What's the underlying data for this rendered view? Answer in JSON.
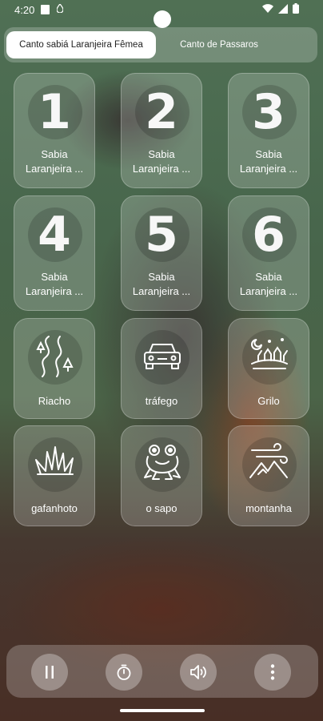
{
  "status_bar": {
    "time": "4:20",
    "drop_glyph": "•"
  },
  "tabs": [
    {
      "label": "Canto sabiá Laranjeira Fêmea",
      "active": true
    },
    {
      "label": "Canto de Passaros",
      "active": false
    }
  ],
  "sounds": [
    {
      "number": "1",
      "label_line1": "Sabia",
      "label_line2": "Laranjeira ..."
    },
    {
      "number": "2",
      "label_line1": "Sabia",
      "label_line2": "Laranjeira ..."
    },
    {
      "number": "3",
      "label_line1": "Sabia",
      "label_line2": "Laranjeira ..."
    },
    {
      "number": "4",
      "label_line1": "Sabia",
      "label_line2": "Laranjeira ..."
    },
    {
      "number": "5",
      "label_line1": "Sabia",
      "label_line2": "Laranjeira ..."
    },
    {
      "number": "6",
      "label_line1": "Sabia",
      "label_line2": "Laranjeira ..."
    }
  ],
  "ambient": [
    {
      "label": "Riacho",
      "icon": "river-icon"
    },
    {
      "label": "tráfego",
      "icon": "car-icon"
    },
    {
      "label": "Grilo",
      "icon": "cricket-night-icon"
    },
    {
      "label": "gafanhoto",
      "icon": "grass-icon"
    },
    {
      "label": "o sapo",
      "icon": "frog-icon"
    },
    {
      "label": "montanha",
      "icon": "mountain-wind-icon"
    }
  ],
  "controls": [
    {
      "name": "pause-icon"
    },
    {
      "name": "timer-icon"
    },
    {
      "name": "volume-icon"
    },
    {
      "name": "more-vertical-icon"
    }
  ]
}
